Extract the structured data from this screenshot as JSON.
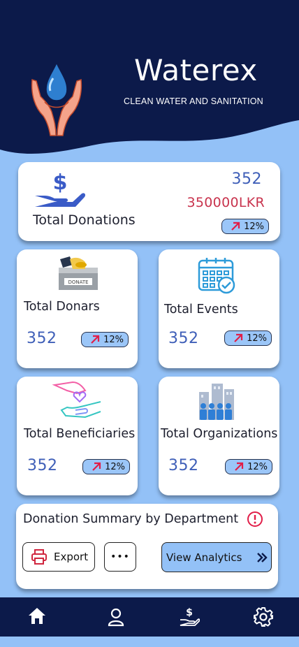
{
  "header": {
    "app_name": "Waterex",
    "tagline": "CLEAN WATER AND SANITATION"
  },
  "colors": {
    "navy": "#0c1a4a",
    "background": "#93c1f7",
    "number_blue": "#3f5fb8",
    "amount_red": "#c8334d",
    "trend_red": "#e11d48"
  },
  "total_donations": {
    "label": "Total Donations",
    "count": "352",
    "amount": "350000LKR",
    "change": "12%",
    "icon": "hand-dollar-icon"
  },
  "stats": [
    {
      "label": "Total Donars",
      "value": "352",
      "change": "12%",
      "icon": "donation-box-icon"
    },
    {
      "label": "Total Events",
      "value": "352",
      "change": "12%",
      "icon": "calendar-check-icon"
    },
    {
      "label": "Total Beneficiaries",
      "value": "352",
      "change": "12%",
      "icon": "hands-heart-icon"
    },
    {
      "label": "Total Organizations",
      "value": "352",
      "change": "12%",
      "icon": "organization-icon"
    }
  ],
  "summary": {
    "title": "Donation Summary by Department",
    "export_label": "Export",
    "more_label": "•••",
    "analytics_label": "View Analytics",
    "info_icon": "alert-circle-icon"
  },
  "nav": {
    "items": [
      "home-icon",
      "user-icon",
      "donate-icon",
      "settings-icon"
    ]
  }
}
